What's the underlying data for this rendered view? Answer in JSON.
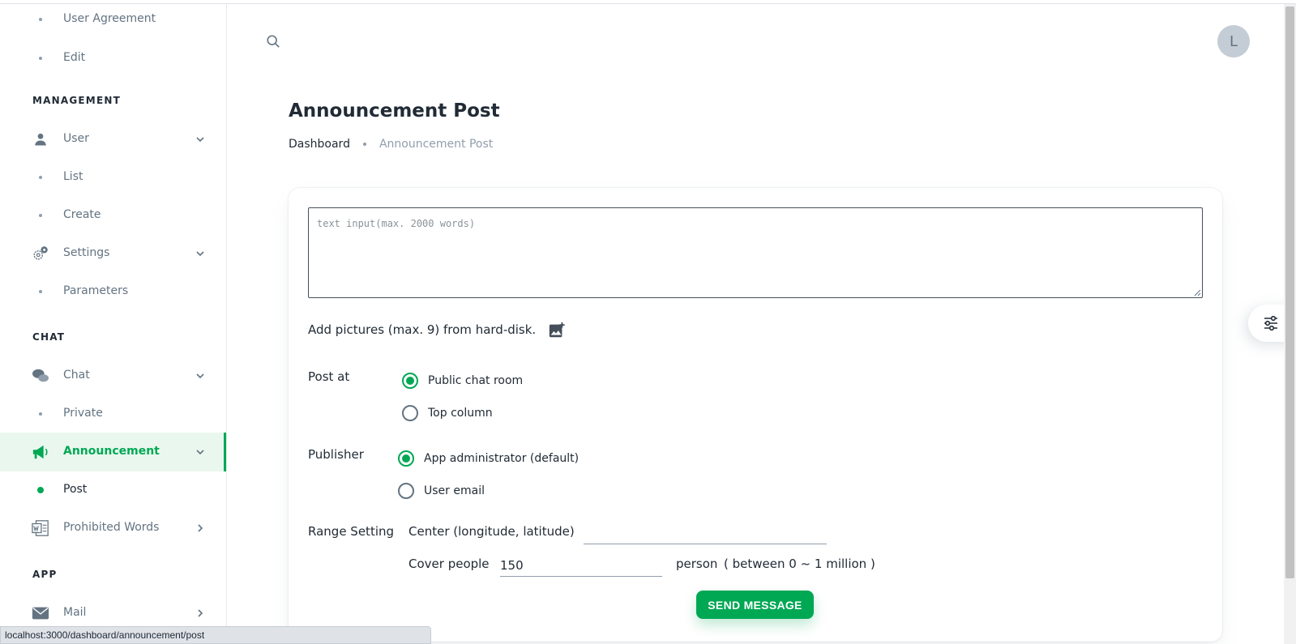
{
  "sidebar": {
    "items": [
      {
        "label": "User Agreement"
      },
      {
        "label": "Edit"
      },
      {
        "section": "MANAGEMENT"
      },
      {
        "label": "User",
        "icon": "user-icon"
      },
      {
        "label": "List"
      },
      {
        "label": "Create"
      },
      {
        "label": "Settings",
        "icon": "gear-icon"
      },
      {
        "label": "Parameters"
      },
      {
        "section": "CHAT"
      },
      {
        "label": "Chat",
        "icon": "chat-icon"
      },
      {
        "label": "Private"
      },
      {
        "label": "Announcement",
        "icon": "megaphone-icon",
        "active": true
      },
      {
        "label": "Post",
        "active": true
      },
      {
        "label": "Prohibited Words",
        "icon": "word-doc-icon"
      },
      {
        "section": "APP"
      },
      {
        "label": "Mail",
        "icon": "mail-icon"
      }
    ]
  },
  "header": {
    "avatar_initial": "L"
  },
  "page": {
    "title": "Announcement Post",
    "breadcrumb": [
      "Dashboard",
      "Announcement Post"
    ]
  },
  "form": {
    "text_placeholder": "text input(max. 2000 words)",
    "pictures_label": "Add pictures (max. 9) from hard-disk.",
    "post_at": {
      "label": "Post at",
      "options": [
        "Public chat room",
        "Top column"
      ],
      "selected": "Public chat room"
    },
    "publisher": {
      "label": "Publisher",
      "options": [
        "App administrator (default)",
        "User email"
      ],
      "selected": "App administrator (default)"
    },
    "range": {
      "label": "Range Setting",
      "center_label": "Center (longitude, latitude)",
      "center_value": "",
      "cover_label": "Cover people",
      "cover_value": "150",
      "cover_unit": "person",
      "cover_hint": "( between 0 ~ 1 million )"
    },
    "submit_label": "SEND MESSAGE"
  },
  "status_url": "localhost:3000/dashboard/announcement/post",
  "colors": {
    "accent": "#00a854",
    "text": "#212b36",
    "muted": "#637381"
  }
}
